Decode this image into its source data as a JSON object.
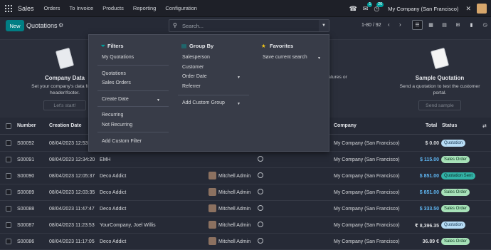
{
  "topbar": {
    "app_name": "Sales",
    "menu": [
      "Orders",
      "To Invoice",
      "Products",
      "Reporting",
      "Configuration"
    ],
    "chat_badge": "1",
    "activity_badge": "26",
    "company": "My Company (San Francisco)"
  },
  "control": {
    "new_label": "New",
    "title": "Quotations",
    "search_placeholder": "Search...",
    "pager": "1-80 / 92"
  },
  "helper_cards": [
    {
      "title": "Company Data",
      "desc1": "Set your company's data for do",
      "desc2": "header/footer.",
      "button": "Let's start!"
    },
    {
      "title": "",
      "desc1": "ignatures or",
      "desc2": "",
      "button": ""
    },
    {
      "title": "Sample Quotation",
      "desc1": "Send a quotation to test the customer",
      "desc2": "portal.",
      "button": "Send sample"
    }
  ],
  "table": {
    "headers": {
      "number": "Number",
      "creation_date": "Creation Date",
      "company": "Company",
      "total": "Total",
      "status": "Status"
    },
    "rows": [
      {
        "number": "S00092",
        "date": "08/04/2023 12:53",
        "customer": "",
        "salesperson": "",
        "company": "My Company (San Francisco)",
        "total": "$ 0.00",
        "status": "Quotation"
      },
      {
        "number": "S00091",
        "date": "08/04/2023 12:34:20",
        "customer": "EMH",
        "salesperson": "",
        "company": "My Company (San Francisco)",
        "total": "$ 115.00",
        "status": "Sales Order"
      },
      {
        "number": "S00090",
        "date": "08/04/2023 12:05:37",
        "customer": "Deco Addict",
        "salesperson": "Mitchell Admin",
        "company": "My Company (San Francisco)",
        "total": "$ 851.00",
        "status": "Quotation Sent"
      },
      {
        "number": "S00089",
        "date": "08/04/2023 12:03:35",
        "customer": "Deco Addict",
        "salesperson": "Mitchell Admin",
        "company": "My Company (San Francisco)",
        "total": "$ 851.00",
        "status": "Sales Order"
      },
      {
        "number": "S00088",
        "date": "08/04/2023 11:47:47",
        "customer": "Deco Addict",
        "salesperson": "Mitchell Admin",
        "company": "My Company (San Francisco)",
        "total": "$ 333.50",
        "status": "Sales Order"
      },
      {
        "number": "S00087",
        "date": "08/04/2023 11:23:53",
        "customer": "YourCompany, Joel Willis",
        "salesperson": "Mitchell Admin",
        "company": "My Company (San Francisco)",
        "total": "₹ 8,396.35",
        "status": "Quotation"
      },
      {
        "number": "S00086",
        "date": "08/04/2023 11:17:05",
        "customer": "Deco Addict",
        "salesperson": "Mitchell Admin",
        "company": "My Company (San Francisco)",
        "total": "36.89 €",
        "status": "Sales Order"
      }
    ]
  },
  "filters_panel": {
    "filters": {
      "heading": "Filters",
      "my_quotations": "My Quotations",
      "quotations": "Quotations",
      "sales_orders": "Sales Orders",
      "create_date": "Create Date",
      "recurring": "Recurring",
      "not_recurring": "Not Recurring",
      "add_custom": "Add Custom Filter"
    },
    "group_by": {
      "heading": "Group By",
      "salesperson": "Salesperson",
      "customer": "Customer",
      "order_date": "Order Date",
      "referrer": "Referrer",
      "add_custom": "Add Custom Group"
    },
    "favorites": {
      "heading": "Favorites",
      "save": "Save current search"
    }
  },
  "colors": {
    "accent": "#017e84",
    "topbar": "#1e2028",
    "background": "#262a36",
    "panel": "#383c48",
    "filter_icon": "#00a09d",
    "favorite_icon": "#f0c419",
    "blue_total": "#5fb6f2"
  }
}
